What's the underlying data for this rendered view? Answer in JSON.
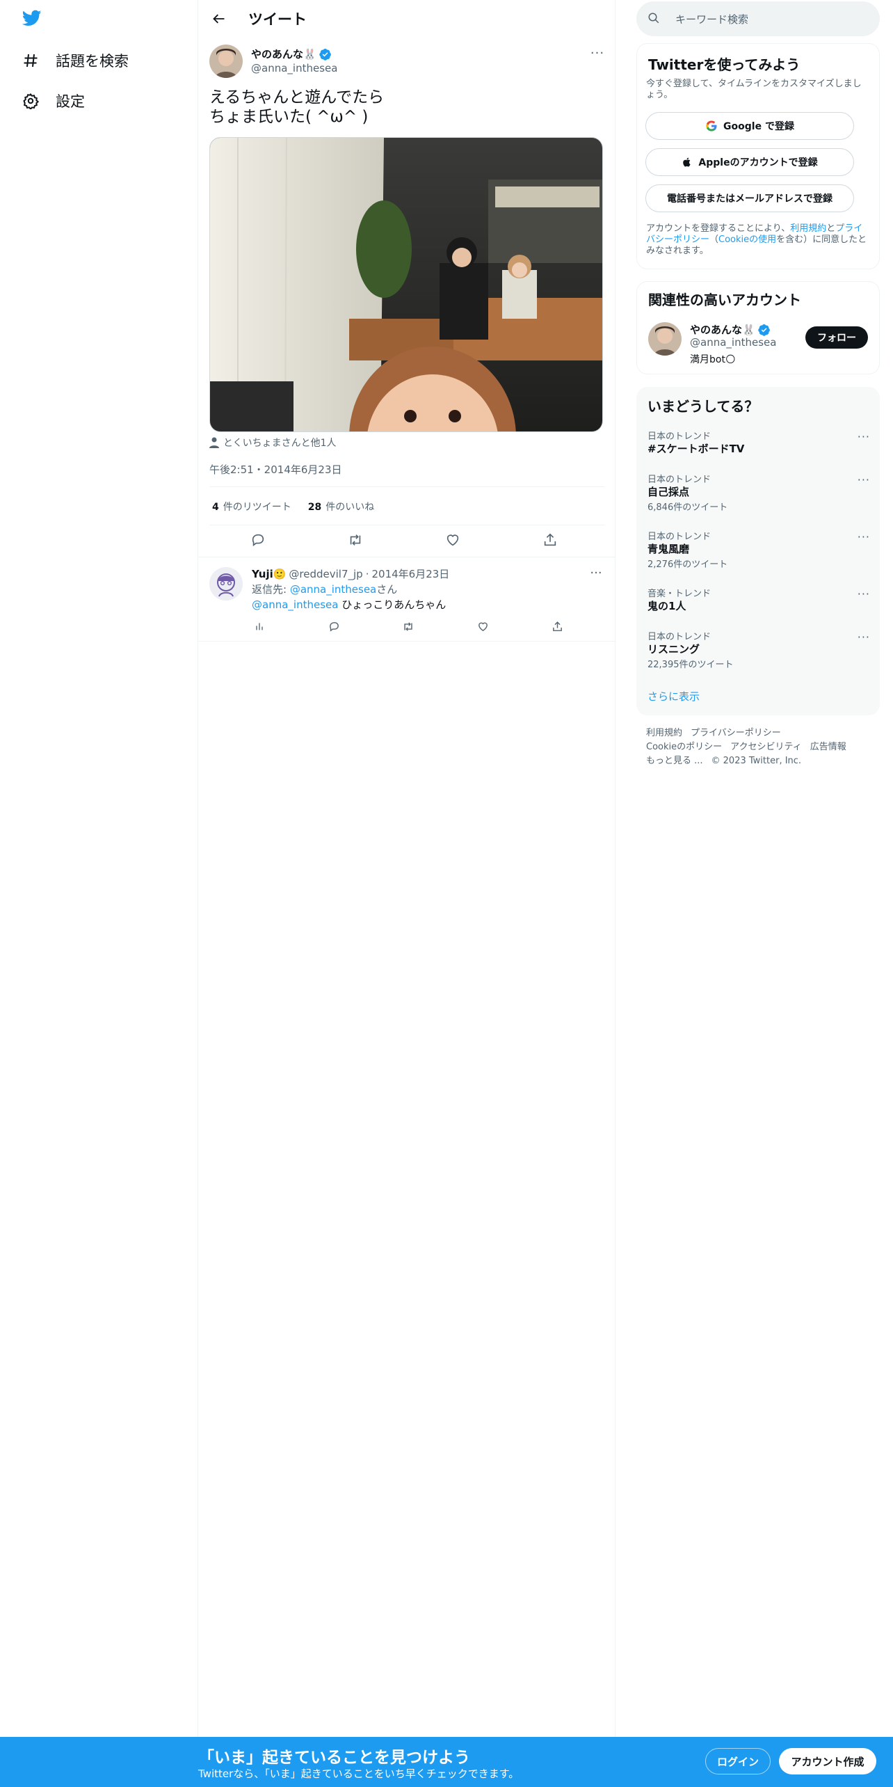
{
  "nav": {
    "logo": "twitter-bird-icon",
    "items": [
      {
        "label": "話題を検索",
        "icon": "hashtag-icon"
      },
      {
        "label": "設定",
        "icon": "gear-icon"
      }
    ]
  },
  "header": {
    "title": "ツイート",
    "back_icon": "arrow-left-icon"
  },
  "tweet": {
    "author_name": "やのあんな🐰",
    "author_handle": "@anna_inthesea",
    "text": "えるちゃんと遊んでたら\nちょま氏いた( ^ω^ )",
    "tagged": "とくいちょまさんと他1人",
    "time": "午後2:51・2014年6月23日",
    "retweets_count": "4",
    "retweets_label": "件のリツイート",
    "likes_count": "28",
    "likes_label": "件のいいね",
    "more_label": "···"
  },
  "reply": {
    "name": "Yuji🙂",
    "handle": "@reddevil7_jp",
    "sep": "·",
    "date": "2014年6月23日",
    "reply_to_prefix": "返信先: ",
    "reply_to_handle": "@anna_inthesea",
    "reply_to_suffix": "さん",
    "mention": "@anna_inthesea",
    "body": " ひょっこりあんちゃん",
    "more_label": "···"
  },
  "sidebar": {
    "search_placeholder": "キーワード検索",
    "signup": {
      "title": "Twitterを使ってみよう",
      "desc": "今すぐ登録して、タイムラインをカスタマイズしましょう。",
      "google_label": "Google で登録",
      "apple_label": "Appleのアカウントで登録",
      "phone_label": "電話番号またはメールアドレスで登録",
      "legal_prefix": "アカウントを登録することにより、",
      "legal_terms": "利用規約",
      "legal_and": "と",
      "legal_privacy": "プライバシーポリシー",
      "legal_open": "（",
      "legal_cookie": "Cookieの使用",
      "legal_suffix": "を含む）に同意したとみなされます。"
    },
    "relevant": {
      "title": "関連性の高いアカウント",
      "name": "やのあんな🐰",
      "handle": "@anna_inthesea",
      "bio": "満月bot🌕",
      "follow_label": "フォロー"
    },
    "trends": {
      "title": "いまどうしてる？",
      "items": [
        {
          "context": "日本のトレンド",
          "name": "#スケートボードTV",
          "count": ""
        },
        {
          "context": "日本のトレンド",
          "name": "自己採点",
          "count": "6,846件のツイート"
        },
        {
          "context": "日本のトレンド",
          "name": "青鬼風磨",
          "count": "2,276件のツイート"
        },
        {
          "context": "音楽・トレンド",
          "name": "鬼の1人",
          "count": ""
        },
        {
          "context": "日本のトレンド",
          "name": "リスニング",
          "count": "22,395件のツイート"
        }
      ],
      "more_label": "···",
      "show_more": "さらに表示"
    },
    "footer": {
      "terms": "利用規約",
      "privacy": "プライバシーポリシー",
      "cookie": "Cookieのポリシー",
      "accessibility": "アクセシビリティ",
      "ads": "広告情報",
      "more": "もっと見る ...",
      "copyright": "© 2023 Twitter, Inc."
    }
  },
  "banner": {
    "title": "「いま」起きていることを見つけよう",
    "subtitle": "Twitterなら、「いま」起きていることをいち早くチェックできます。",
    "login": "ログイン",
    "signup": "アカウント作成"
  },
  "colors": {
    "accent": "#1d9bf0",
    "text": "#0f1419",
    "muted": "#536471",
    "border": "#eff3f4"
  }
}
